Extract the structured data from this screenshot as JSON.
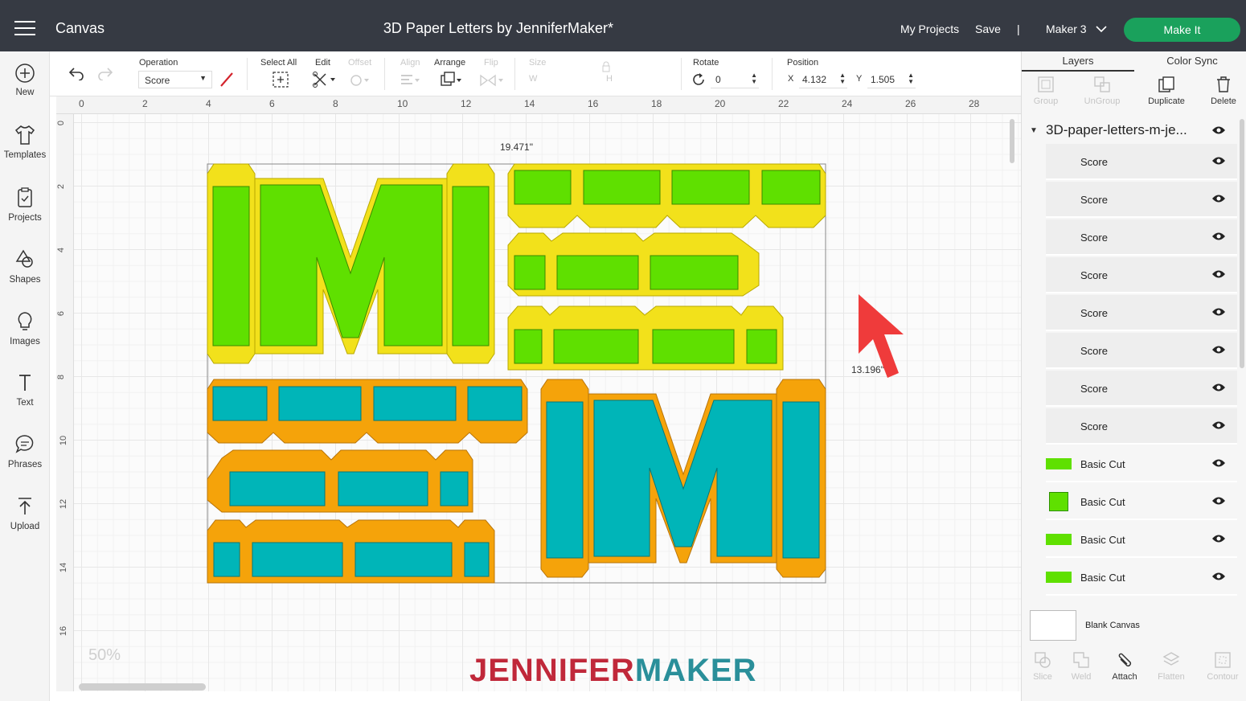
{
  "topbar": {
    "app_title": "Canvas",
    "doc_title": "3D Paper Letters by JenniferMaker*",
    "my_projects": "My Projects",
    "save": "Save",
    "divider": "|",
    "machine": "Maker 3",
    "make_it": "Make It"
  },
  "left_nav": [
    {
      "label": "New",
      "icon": "plus-circle-icon"
    },
    {
      "label": "Templates",
      "icon": "tshirt-icon"
    },
    {
      "label": "Projects",
      "icon": "clipboard-icon"
    },
    {
      "label": "Shapes",
      "icon": "shapes-icon"
    },
    {
      "label": "Images",
      "icon": "lightbulb-icon"
    },
    {
      "label": "Text",
      "icon": "text-icon"
    },
    {
      "label": "Phrases",
      "icon": "speech-bubble-icon"
    },
    {
      "label": "Upload",
      "icon": "upload-icon"
    }
  ],
  "editbar": {
    "operation_label": "Operation",
    "operation_value": "Score",
    "select_all": "Select All",
    "edit": "Edit",
    "offset": "Offset",
    "align": "Align",
    "arrange": "Arrange",
    "flip": "Flip",
    "size": "Size",
    "size_w": "W",
    "size_h": "H",
    "rotate_label": "Rotate",
    "rotate_value": "0",
    "position_label": "Position",
    "pos_x_label": "X",
    "pos_x": "4.132",
    "pos_y_label": "Y",
    "pos_y": "1.505"
  },
  "ruler": {
    "top": [
      "0",
      "2",
      "4",
      "6",
      "8",
      "10",
      "12",
      "14",
      "16",
      "18",
      "20",
      "22",
      "24",
      "26",
      "28"
    ],
    "left": [
      "0",
      "2",
      "4",
      "6",
      "8",
      "10",
      "12",
      "14",
      "16"
    ]
  },
  "canvas": {
    "width_dim": "19.471\"",
    "height_dim": "13.196\"",
    "zoom": "50%",
    "brand_left": "JENNIFER",
    "brand_right": "MAKER",
    "letter": "M"
  },
  "colors": {
    "topbar": "#363a43",
    "make_it": "#1aa15c",
    "yellow": "#f2e11b",
    "green": "#5fe000",
    "orange": "#f5a30a",
    "teal": "#00b5b8"
  },
  "panel": {
    "tabs": [
      "Layers",
      "Color Sync"
    ],
    "tools": [
      {
        "label": "Group",
        "enabled": false
      },
      {
        "label": "UnGroup",
        "enabled": false
      },
      {
        "label": "Duplicate",
        "enabled": true
      },
      {
        "label": "Delete",
        "enabled": true
      }
    ],
    "group_name": "3D-paper-letters-m-je...",
    "layers": [
      {
        "name": "Score",
        "swatch": ""
      },
      {
        "name": "Score",
        "swatch": ""
      },
      {
        "name": "Score",
        "swatch": ""
      },
      {
        "name": "Score",
        "swatch": ""
      },
      {
        "name": "Score",
        "swatch": ""
      },
      {
        "name": "Score",
        "swatch": ""
      },
      {
        "name": "Score",
        "swatch": ""
      },
      {
        "name": "Score",
        "swatch": ""
      },
      {
        "name": "Basic Cut",
        "swatch": "#5fe000"
      },
      {
        "name": "Basic Cut",
        "swatch": "#5fe000"
      },
      {
        "name": "Basic Cut",
        "swatch": "#5fe000"
      },
      {
        "name": "Basic Cut",
        "swatch": "#5fe000"
      }
    ],
    "blank_canvas": "Blank Canvas",
    "bottom_tools": [
      {
        "label": "Slice",
        "enabled": false
      },
      {
        "label": "Weld",
        "enabled": false
      },
      {
        "label": "Attach",
        "enabled": true
      },
      {
        "label": "Flatten",
        "enabled": false
      },
      {
        "label": "Contour",
        "enabled": false
      }
    ]
  }
}
